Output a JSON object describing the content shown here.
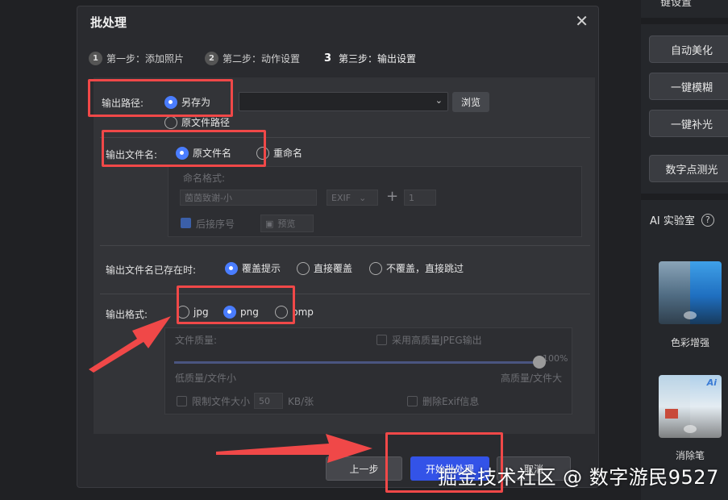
{
  "side_panel": {
    "top_cut_label": "键设置",
    "buttons": [
      "自动美化",
      "一键模糊",
      "一键补光",
      "数字点测光"
    ],
    "ai_section_title": "AI 实验室",
    "help_icon": "question-circle-icon",
    "items": [
      {
        "label": "色彩增强"
      },
      {
        "label": "消除笔"
      }
    ]
  },
  "dialog": {
    "title": "批处理",
    "close_icon": "close-icon",
    "steps": [
      {
        "num": "1",
        "label": "第一步：添加照片"
      },
      {
        "num": "2",
        "label": "第二步：动作设置"
      },
      {
        "num": "3",
        "label": "第三步：输出设置"
      }
    ],
    "output_path": {
      "label": "输出路径:",
      "options": [
        "另存为",
        "原文件路径"
      ],
      "selected": "另存为",
      "path_value": "",
      "browse_label": "浏览"
    },
    "output_filename": {
      "label": "输出文件名:",
      "options": [
        "原文件名",
        "重命名"
      ],
      "selected": "原文件名",
      "rename_format_label": "命名格式:",
      "rename_format_value": "茵茵致谢-小",
      "exif_label": "EXIF",
      "seq_value": "1",
      "append_seq_label": "后接序号",
      "preview_label": "预览"
    },
    "exists": {
      "label": "输出文件名已存在时:",
      "options": [
        "覆盖提示",
        "直接覆盖",
        "不覆盖，直接跳过"
      ],
      "selected": "覆盖提示"
    },
    "format": {
      "label": "输出格式:",
      "options": [
        "jpg",
        "png",
        "bmp"
      ],
      "selected": "png",
      "quality_label": "文件质量:",
      "hq_jpeg_label": "采用高质量JPEG输出",
      "quality_value": "100%",
      "low_label": "低质量/文件小",
      "high_label": "高质量/文件大",
      "limit_size_label": "限制文件大小",
      "limit_size_value": "50",
      "limit_size_unit": "KB/张",
      "delete_exif_label": "删除Exif信息"
    },
    "footer": {
      "prev_label": "上一步",
      "start_label": "开始批处理",
      "cancel_label": "取消"
    }
  },
  "watermark": "掘金技术社区 @ 数字游民9527",
  "colors": {
    "accent": "#4a7dff",
    "start_button": "#3353e8",
    "annotation": "#f04848"
  }
}
